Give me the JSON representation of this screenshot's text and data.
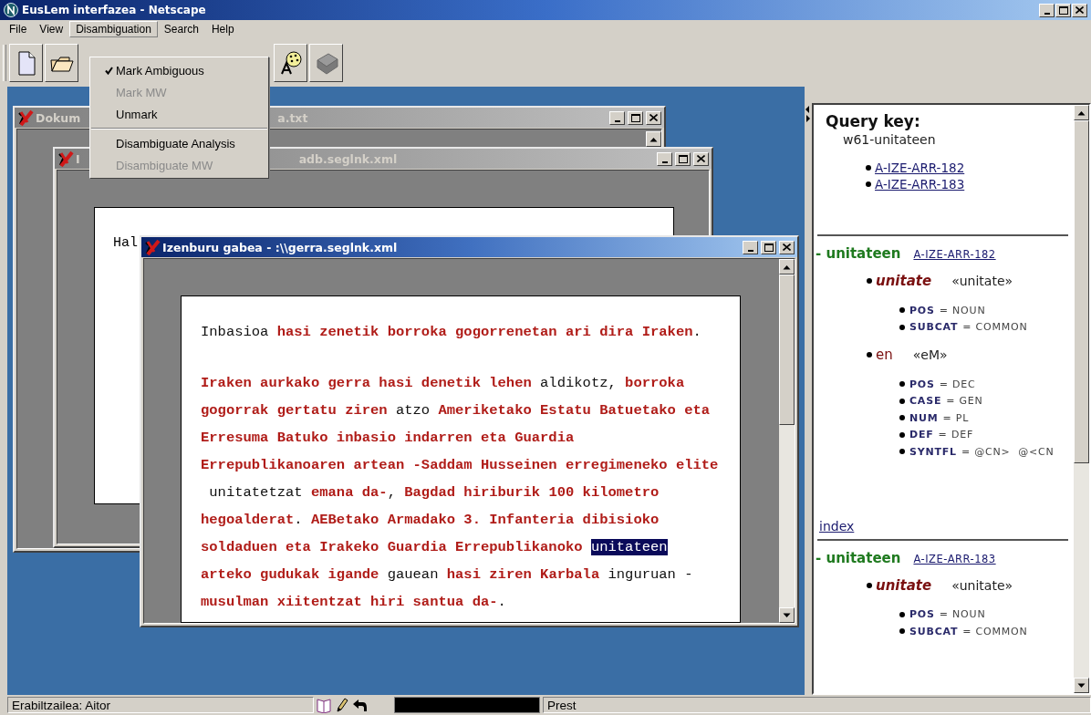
{
  "window": {
    "title": "EusLem interfazea - Netscape"
  },
  "menu_bar": [
    {
      "label": "File",
      "selected": false
    },
    {
      "label": "View",
      "selected": false
    },
    {
      "label": "Disambiguation",
      "selected": true
    },
    {
      "label": "Search",
      "selected": false
    },
    {
      "label": "Help",
      "selected": false
    }
  ],
  "open_menu": [
    {
      "kind": "item",
      "label": "Mark Ambiguous",
      "checked": true,
      "disabled": false
    },
    {
      "kind": "item",
      "label": "Mark MW",
      "checked": false,
      "disabled": true
    },
    {
      "kind": "item",
      "label": "Unmark",
      "checked": false,
      "disabled": false
    },
    {
      "kind": "separator"
    },
    {
      "kind": "item",
      "label": "Disambiguate Analysis",
      "checked": false,
      "disabled": false
    },
    {
      "kind": "item",
      "label": "Disambiguate MW",
      "checked": false,
      "disabled": true
    }
  ],
  "windows": [
    {
      "title_parts": [
        "Dokum",
        "a.txt"
      ],
      "active": false
    },
    {
      "title_parts": [
        "I",
        "adb.seglnk.xml"
      ],
      "active": false,
      "preview_text": "Hal"
    },
    {
      "title_parts": [
        "Izenburu gabea - :\\\\gerra.seglnk.xml"
      ],
      "active": true,
      "paragraphs": [
        [
          [
            {
              "text": "Inbasioa ",
              "ambiguous": false,
              "selected": false
            },
            {
              "text": "hasi zenetik borroka gogorrenetan ari dira Iraken",
              "ambiguous": true,
              "selected": false
            },
            {
              "text": ".",
              "ambiguous": false,
              "selected": false
            }
          ]
        ],
        [
          [
            {
              "text": "Iraken aurkako gerra hasi denetik lehen",
              "ambiguous": true,
              "selected": false
            },
            {
              "text": " aldikotz, ",
              "ambiguous": false,
              "selected": false
            },
            {
              "text": "borroka",
              "ambiguous": true,
              "selected": false
            }
          ],
          [
            {
              "text": "gogorrak gertatu ziren",
              "ambiguous": true,
              "selected": false
            },
            {
              "text": " atzo ",
              "ambiguous": false,
              "selected": false
            },
            {
              "text": "Ameriketako Estatu Batuetako eta",
              "ambiguous": true,
              "selected": false
            }
          ],
          [
            {
              "text": "Erresuma Batuko inbasio indarren eta Guardia",
              "ambiguous": true,
              "selected": false
            }
          ],
          [
            {
              "text": "Errepublikanoaren artean -Saddam Husseinen erregimeneko elite",
              "ambiguous": true,
              "selected": false
            }
          ],
          [
            {
              "text": " unitatetzat ",
              "ambiguous": false,
              "selected": false
            },
            {
              "text": "emana da-",
              "ambiguous": true,
              "selected": false
            },
            {
              "text": ", ",
              "ambiguous": false,
              "selected": false
            },
            {
              "text": "Bagdad hiriburik 100 kilometro",
              "ambiguous": true,
              "selected": false
            }
          ],
          [
            {
              "text": "hegoalderat",
              "ambiguous": true,
              "selected": false
            },
            {
              "text": ". ",
              "ambiguous": false,
              "selected": false
            },
            {
              "text": "AEBetako Armadako 3. Infanteria dibisioko",
              "ambiguous": true,
              "selected": false
            }
          ],
          [
            {
              "text": "soldaduen eta Irakeko Guardia Errepublikanoko ",
              "ambiguous": true,
              "selected": false
            },
            {
              "text": "unitateen",
              "ambiguous": false,
              "selected": true
            }
          ],
          [
            {
              "text": "arteko gudukak igande",
              "ambiguous": true,
              "selected": false
            },
            {
              "text": " gauean ",
              "ambiguous": false,
              "selected": false
            },
            {
              "text": "hasi ziren Karbala",
              "ambiguous": true,
              "selected": false
            },
            {
              "text": " inguruan -",
              "ambiguous": false,
              "selected": false
            }
          ],
          [
            {
              "text": "musulman xiitentzat hiri santua da-",
              "ambiguous": true,
              "selected": false
            },
            {
              "text": ".",
              "ambiguous": false,
              "selected": false
            }
          ]
        ]
      ]
    }
  ],
  "query_panel": {
    "heading": "Query key:",
    "key": "w61-unitateen",
    "links": [
      "A-IZE-ARR-182",
      "A-IZE-ARR-183"
    ],
    "analyses": [
      {
        "word": "- unitateen",
        "link": "A-IZE-ARR-182",
        "morphemes": [
          {
            "kind": "root",
            "form": "unitate",
            "gloss": "«unitate»",
            "features": [
              {
                "name": "POS",
                "value": "= NOUN"
              },
              {
                "name": "SUBCAT",
                "value": "= COMMON"
              }
            ]
          },
          {
            "kind": "suffix",
            "form": "en",
            "gloss": "«eM»",
            "features": [
              {
                "name": "POS",
                "value": "= DEC"
              },
              {
                "name": "CASE",
                "value": "= GEN"
              },
              {
                "name": "NUM",
                "value": "= PL"
              },
              {
                "name": "DEF",
                "value": "= DEF"
              },
              {
                "name": "SYNTFL",
                "value": "= @CN>  @<CN"
              }
            ]
          }
        ],
        "after_link": "index"
      },
      {
        "word": "- unitateen",
        "link": "A-IZE-ARR-183",
        "morphemes": [
          {
            "kind": "root",
            "form": "unitate",
            "gloss": "«unitate»",
            "features": [
              {
                "name": "POS",
                "value": "= NOUN"
              },
              {
                "name": "SUBCAT",
                "value": "= COMMON"
              }
            ]
          }
        ]
      }
    ]
  },
  "status_bar": {
    "user": "Erabiltzailea: Aitor",
    "status": "Prest"
  }
}
